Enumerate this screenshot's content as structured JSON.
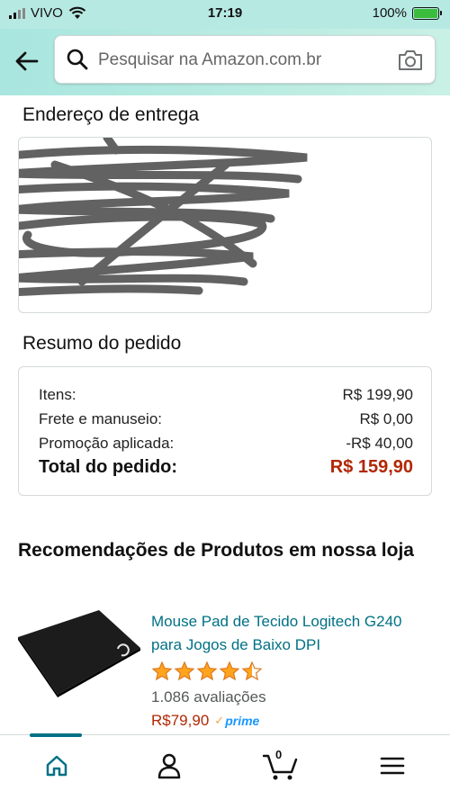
{
  "status_bar": {
    "carrier": "VIVO",
    "time": "17:19",
    "battery": "100%"
  },
  "search": {
    "placeholder": "Pesquisar na Amazon.com.br"
  },
  "address": {
    "title": "Endereço de entrega"
  },
  "summary": {
    "title": "Resumo do pedido",
    "rows": [
      {
        "label": "Itens:",
        "value": "R$ 199,90"
      },
      {
        "label": "Frete e manuseio:",
        "value": "R$ 0,00"
      },
      {
        "label": "Promoção aplicada:",
        "value": "-R$ 40,00"
      }
    ],
    "total_label": "Total do pedido:",
    "total_value": "R$ 159,90"
  },
  "recommendations": {
    "title": "Recomendações de Produtos em nossa loja",
    "product": {
      "name": "Mouse Pad de Tecido Logitech G240 para Jogos de Baixo DPI",
      "rating": 4.5,
      "reviews": "1.086 avaliações",
      "price": "R$79,90",
      "prime": "prime"
    }
  },
  "bottom_nav": {
    "cart_count": "0",
    "items": [
      "home-icon",
      "user-icon",
      "cart-icon",
      "menu-icon"
    ]
  },
  "colors": {
    "accent": "#007185",
    "price": "#b12704",
    "header": "#a8e6df",
    "star": "#ffa41c",
    "prime": "#1a98ff"
  }
}
